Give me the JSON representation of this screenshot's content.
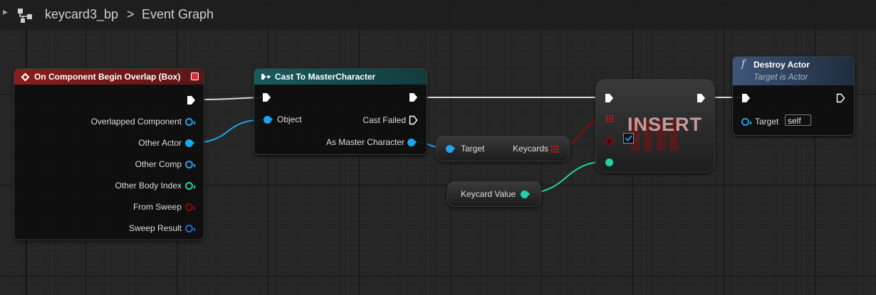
{
  "breadcrumb": {
    "blueprint": "keycard3_bp",
    "separator": ">",
    "graph": "Event Graph"
  },
  "colors": {
    "exec": "#ffffff",
    "object": "#1ea5ec",
    "struct": "#1f6bd1",
    "integer": "#21d3a3",
    "boolean": "#8e0a0a",
    "event_header": "#8a1d1d",
    "cast_header": "#1a5a5c",
    "function_header": "#28374e"
  },
  "nodes": {
    "event": {
      "title": "On Component Begin Overlap (Box)",
      "pins": [
        "Overlapped Component",
        "Other Actor",
        "Other Comp",
        "Other Body Index",
        "From Sweep",
        "Sweep Result"
      ]
    },
    "cast": {
      "title": "Cast To MasterCharacter",
      "object_pin": "Object",
      "cast_failed": "Cast Failed",
      "as_pin": "As Master Character"
    },
    "get_keycards": {
      "target": "Target",
      "keycards": "Keycards"
    },
    "keycard_value": {
      "label": "Keycard Value"
    },
    "insert": {
      "title": "INSERT"
    },
    "destroy": {
      "title": "Destroy Actor",
      "subtitle": "Target is Actor",
      "target_label": "Target",
      "target_value": "self"
    }
  }
}
